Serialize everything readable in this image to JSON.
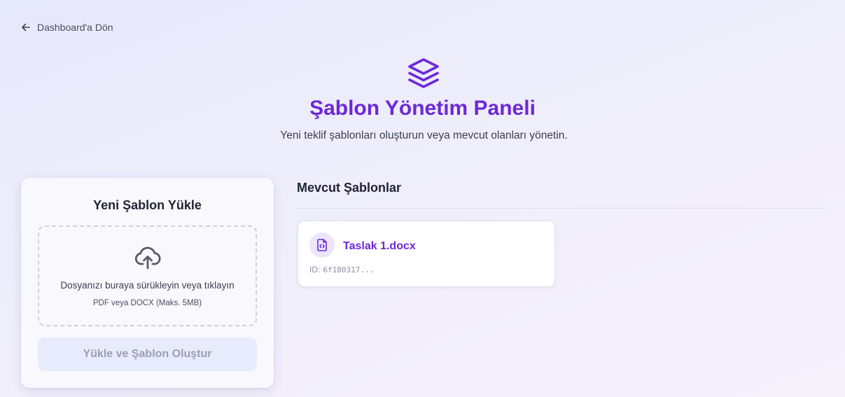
{
  "nav": {
    "back_label": "Dashboard'a Dön"
  },
  "header": {
    "title": "Şablon Yönetim Paneli",
    "subtitle": "Yeni teklif şablonları oluşturun veya mevcut olanları yönetin."
  },
  "upload": {
    "title": "Yeni Şablon Yükle",
    "dropzone_text": "Dosyanızı buraya sürükleyin veya tıklayın",
    "dropzone_hint": "PDF veya DOCX (Maks. 5MB)",
    "button_label": "Yükle ve Şablon Oluştur"
  },
  "templates": {
    "section_title": "Mevcut Şablonlar",
    "items": [
      {
        "name": "Taslak 1.docx",
        "id_label": "ID:",
        "id_value": "6f180317..."
      }
    ]
  },
  "icons": {
    "back": "arrow-left-icon",
    "hero": "layers-icon",
    "upload": "cloud-upload-icon",
    "file": "file-code-icon"
  },
  "colors": {
    "accent": "#6d28d9",
    "button_disabled_bg": "#e8ebfb",
    "button_disabled_text": "#9a9fb6",
    "icon_bg": "#ebe6fb"
  }
}
